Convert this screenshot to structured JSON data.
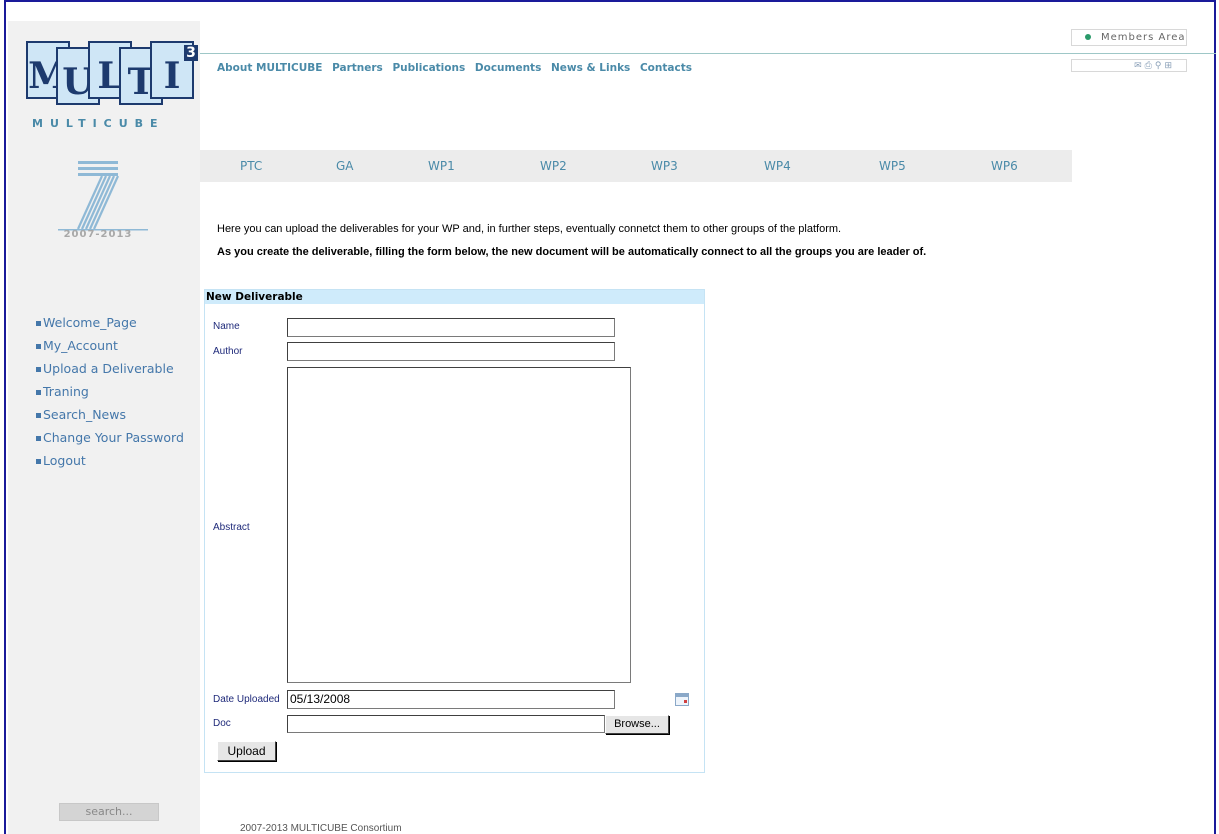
{
  "branding": {
    "logo_letters": [
      "M",
      "U",
      "L",
      "T",
      "I"
    ],
    "logo_superscript": "3",
    "logo_word": "MULTICUBE",
    "fp7_years": "2007-2013"
  },
  "top_nav": {
    "items": [
      "About MULTICUBE",
      "Partners",
      "Publications",
      "Documents",
      "News & Links",
      "Contacts"
    ]
  },
  "members_area": {
    "label": "Members Area"
  },
  "toolbar_icons": [
    "mail-icon",
    "print-icon",
    "search-icon",
    "sitemap-icon"
  ],
  "wp_tabs": [
    "PTC",
    "GA",
    "WP1",
    "WP2",
    "WP3",
    "WP4",
    "WP5",
    "WP6"
  ],
  "sidebar": {
    "items": [
      "Welcome_Page",
      "My_Account",
      "Upload a Deliverable",
      "Traning",
      "Search_News",
      "Change Your Password",
      "Logout"
    ],
    "search_label": "search..."
  },
  "intro": {
    "line1": "Here you can upload the deliverables for your WP and, in further steps, eventually connetct them to other groups of the platform.",
    "line2": "As you create the deliverable, filling the form below, the new document will be automatically connect to all the groups you are leader of."
  },
  "form": {
    "title": "New Deliverable",
    "name_label": "Name",
    "name_value": "",
    "author_label": "Author",
    "author_value": "",
    "abstract_label": "Abstract",
    "abstract_value": "",
    "date_label": "Date Uploaded",
    "date_value": "05/13/2008",
    "doc_label": "Doc",
    "doc_value": "",
    "browse_label": "Browse...",
    "upload_label": "Upload"
  },
  "footer": {
    "text": "2007-2013 MULTICUBE Consortium"
  },
  "colors": {
    "accent": "#4a8aa8",
    "menu": "#4477aa",
    "form_header": "#cfebfb",
    "frame": "#1a1a9a"
  }
}
